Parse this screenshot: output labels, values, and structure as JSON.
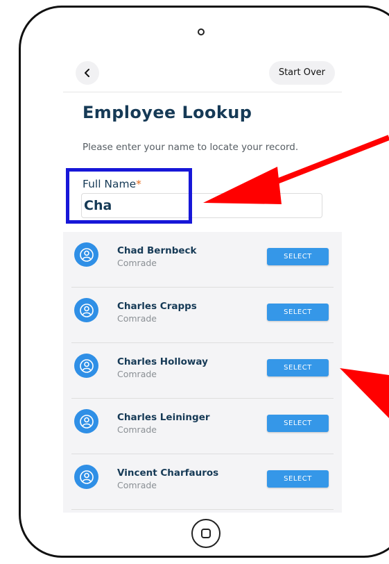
{
  "header": {
    "back_label": "<",
    "start_over_label": "Start Over"
  },
  "page": {
    "title": "Employee Lookup",
    "subtitle": "Please enter your name to locate your record."
  },
  "form": {
    "full_name_label": "Full Name",
    "required_mark": "*",
    "full_name_value": "Cha"
  },
  "results": [
    {
      "name": "Chad Bernbeck",
      "role": "Comrade",
      "select_label": "SELECT"
    },
    {
      "name": "Charles Crapps",
      "role": "Comrade",
      "select_label": "SELECT"
    },
    {
      "name": "Charles Holloway",
      "role": "Comrade",
      "select_label": "SELECT"
    },
    {
      "name": "Charles Leininger",
      "role": "Comrade",
      "select_label": "SELECT"
    },
    {
      "name": "Vincent Charfauros",
      "role": "Comrade",
      "select_label": "SELECT"
    }
  ],
  "colors": {
    "title": "#163a56",
    "accent": "#3597e8",
    "required": "#e36b1e",
    "highlight_box": "#1717d8",
    "annotation_arrow": "#ff0000"
  },
  "icons": {
    "back": "chevron-left-icon",
    "avatar": "user-circle-icon",
    "camera": "camera-icon",
    "home": "home-button-icon"
  }
}
